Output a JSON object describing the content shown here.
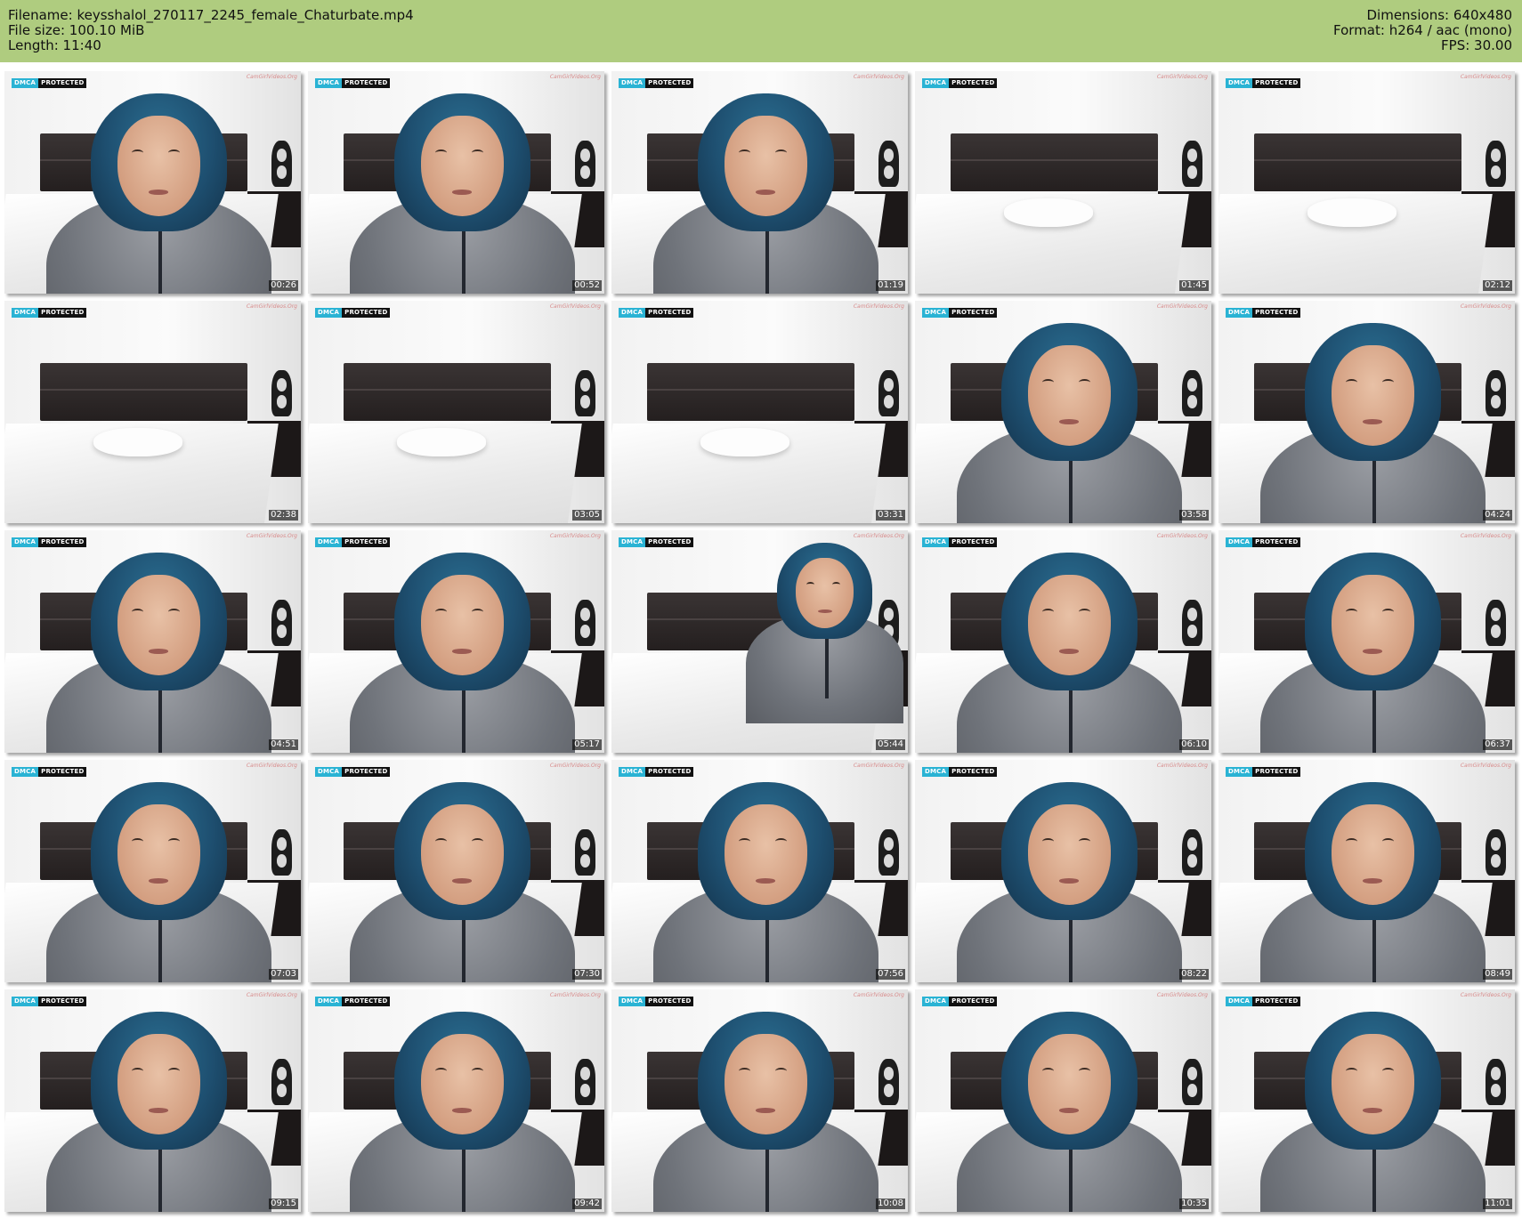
{
  "header": {
    "filename_line": "Filename: keysshalol_270117_2245_female_Chaturbate.mp4",
    "filesize_line": "File size: 100.10 MiB",
    "length_line": "Length: 11:40",
    "dimensions_line": "Dimensions: 640x480",
    "format_line": "Format: h264 / aac (mono)",
    "fps_line": "FPS: 30.00"
  },
  "badge": {
    "left": "DMCA",
    "right": "PROTECTED"
  },
  "watermark": "CamGirlVideos.Org",
  "colors": {
    "header_bg": "#afcc7f",
    "badge_accent": "#2ab3d4",
    "hair": "#1e4f70"
  },
  "thumbnails": [
    {
      "time": "00:26",
      "scene": "person"
    },
    {
      "time": "00:52",
      "scene": "person"
    },
    {
      "time": "01:19",
      "scene": "person"
    },
    {
      "time": "01:45",
      "scene": "bed"
    },
    {
      "time": "02:12",
      "scene": "bed"
    },
    {
      "time": "02:38",
      "scene": "bed"
    },
    {
      "time": "03:05",
      "scene": "bed"
    },
    {
      "time": "03:31",
      "scene": "bed"
    },
    {
      "time": "03:58",
      "scene": "person"
    },
    {
      "time": "04:24",
      "scene": "person"
    },
    {
      "time": "04:51",
      "scene": "person"
    },
    {
      "time": "05:17",
      "scene": "person"
    },
    {
      "time": "05:44",
      "scene": "person-far"
    },
    {
      "time": "06:10",
      "scene": "person"
    },
    {
      "time": "06:37",
      "scene": "person"
    },
    {
      "time": "07:03",
      "scene": "person"
    },
    {
      "time": "07:30",
      "scene": "person"
    },
    {
      "time": "07:56",
      "scene": "person"
    },
    {
      "time": "08:22",
      "scene": "person"
    },
    {
      "time": "08:49",
      "scene": "person"
    },
    {
      "time": "09:15",
      "scene": "person"
    },
    {
      "time": "09:42",
      "scene": "person"
    },
    {
      "time": "10:08",
      "scene": "person"
    },
    {
      "time": "10:35",
      "scene": "person"
    },
    {
      "time": "11:01",
      "scene": "person"
    }
  ]
}
